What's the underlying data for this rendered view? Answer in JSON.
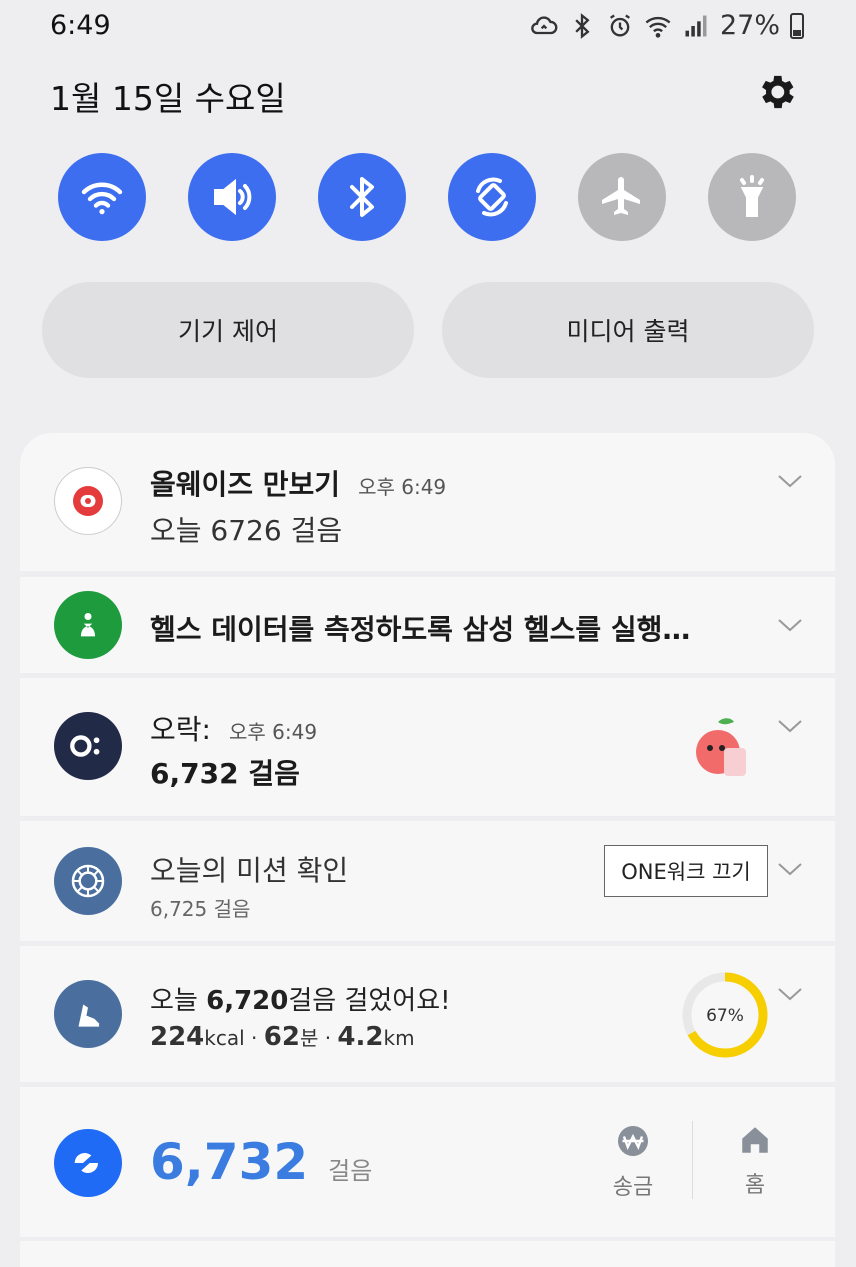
{
  "status_bar": {
    "time": "6:49",
    "battery_percent": "27%"
  },
  "header": {
    "date": "1월 15일 수요일"
  },
  "quick_toggles": [
    {
      "name": "wifi",
      "icon": "wifi-icon",
      "on": true
    },
    {
      "name": "sound",
      "icon": "speaker-icon",
      "on": true
    },
    {
      "name": "bluetooth",
      "icon": "bluetooth-icon",
      "on": true
    },
    {
      "name": "auto-rotate",
      "icon": "rotate-icon",
      "on": true
    },
    {
      "name": "airplane",
      "icon": "airplane-icon",
      "on": false
    },
    {
      "name": "flashlight",
      "icon": "flashlight-icon",
      "on": false
    }
  ],
  "buttons": {
    "device_control": "기기 제어",
    "media_output": "미디어 출력"
  },
  "notifications": {
    "always_pedometer": {
      "app": "올웨이즈 만보기",
      "time": "오후 6:49",
      "text": "오늘 6726 걸음"
    },
    "samsung_health": {
      "text": "헬스 데이터를 측정하도록 삼성 헬스를 실행…"
    },
    "orak": {
      "app": "오락:",
      "time": "오후 6:49",
      "steps": "6,732 걸음"
    },
    "mission": {
      "title": "오늘의 미션 확인",
      "steps": "6,725 걸음",
      "action": "ONE워크 끄기"
    },
    "walk_summary": {
      "prefix": "오늘 ",
      "steps": "6,720",
      "suffix": "걸음 걸었어요!",
      "kcal": "224",
      "kcal_unit": "kcal",
      "minutes": "62",
      "minutes_unit": "분",
      "km": "4.2",
      "km_unit": "km",
      "sep": "·",
      "progress": 0.67,
      "progress_label": "67%"
    },
    "toss": {
      "steps": "6,732",
      "unit": "걸음",
      "send_label": "송금",
      "home_label": "홈"
    }
  },
  "colors": {
    "accent": "#3d6ef0",
    "toggle_off": "#b8b8ba",
    "progress": "#f7cf00",
    "toss_blue": "#1f6bf5",
    "health_green": "#1e9b3d",
    "orak_navy": "#212a47",
    "mission_blue": "#4a6f9f"
  }
}
